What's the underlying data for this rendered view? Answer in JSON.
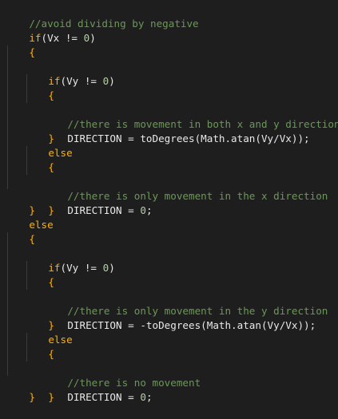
{
  "colors": {
    "background": "#1e1e1e",
    "keyword": "#ffb000",
    "comment": "#6a9955",
    "number": "#b5cea8",
    "text": "#e8e8e8"
  },
  "code": {
    "l01": "//avoid dividing by negative",
    "l02_kw": "if",
    "l02_rest": "(Vx != ",
    "l02_num": "0",
    "l02_end": ")",
    "l03": "{",
    "l04_kw": "if",
    "l04_rest": "(Vy != ",
    "l04_num": "0",
    "l04_end": ")",
    "l05": "{",
    "l06": "//there is movement in both x and y direction",
    "l07": "DIRECTION = toDegrees(Math.atan(Vy/Vx));",
    "l08": "}",
    "l09": "else",
    "l10": "{",
    "l11": "//there is only movement in the x direction",
    "l12_a": "DIRECTION = ",
    "l12_num": "0",
    "l12_b": ";",
    "l13": "}",
    "l14": "}",
    "l15": "else",
    "l16": "{",
    "l17_kw": "if",
    "l17_rest": "(Vy != ",
    "l17_num": "0",
    "l17_end": ")",
    "l18": "{",
    "l19": "//there is only movement in the y direction",
    "l20": "DIRECTION = -toDegrees(Math.atan(Vy/Vx));",
    "l21": "}",
    "l22": "else",
    "l23": "{",
    "l24": "//there is no movement",
    "l25_a": "DIRECTION = ",
    "l25_num": "0",
    "l25_b": ";",
    "l26": "}",
    "l27": "}"
  }
}
